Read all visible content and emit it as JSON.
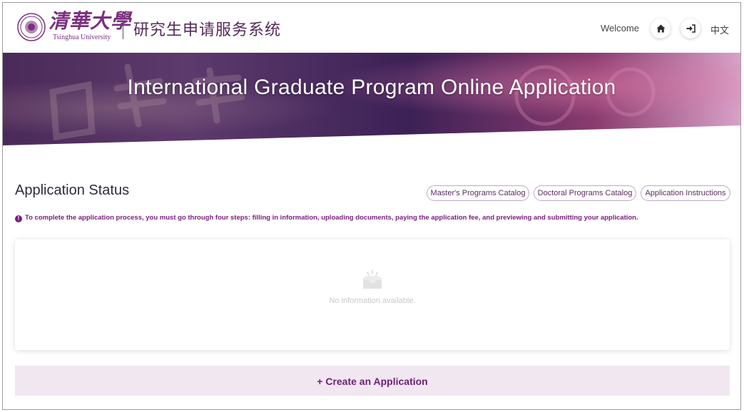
{
  "header": {
    "logo_chinese": "清華大學",
    "logo_english": "Tsinghua University",
    "system_name": "研究生申请服务系统",
    "welcome": "Welcome",
    "language": "中文",
    "home_icon": "home-icon",
    "login_icon": "sign-in-icon"
  },
  "banner": {
    "title": "International Graduate Program Online Application"
  },
  "status": {
    "title": "Application Status",
    "links": {
      "masters": "Master's Programs Catalog",
      "doctoral": "Doctoral Programs Catalog",
      "instructions": "Application Instructions"
    },
    "notice": "To complete the application process, you must go through four steps: filling in information, uploading documents, paying the application fee, and previewing and submitting your application.",
    "empty_text": "No information available.",
    "create_button": "+ Create an Application"
  },
  "colors": {
    "brand_purple": "#7a1f80",
    "banner_dark": "#3c1d55",
    "create_bg": "#f0e7f1"
  }
}
